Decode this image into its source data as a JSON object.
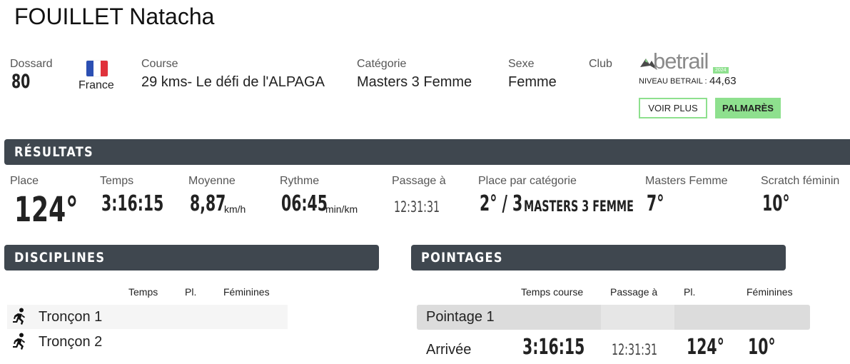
{
  "runner": {
    "name": "FOUILLET Natacha"
  },
  "info": {
    "dossard_label": "Dossard",
    "dossard_value": "80",
    "country": "France",
    "course_label": "Course",
    "course_value": "29 kms- Le défi de l'ALPAGA",
    "categorie_label": "Catégorie",
    "categorie_value": "Masters 3 Femme",
    "sexe_label": "Sexe",
    "sexe_value": "Femme",
    "club_label": "Club"
  },
  "betrail": {
    "logo_text": "betrail",
    "logo_badge": "2024",
    "niveau_label": "NIVEAU BETRAIL :",
    "niveau_value": "44,63",
    "voir_plus": "VOIR PLUS",
    "palmares": "PALMARÈS",
    "logo_color": "#8a8a8a",
    "accent_color": "#8ee08e"
  },
  "sections": {
    "resultats": "RÉSULTATS",
    "disciplines": "DISCIPLINES",
    "pointages": "POINTAGES"
  },
  "results": {
    "place_label": "Place",
    "place_value": "124°",
    "temps_label": "Temps",
    "temps_value": "3:16:15",
    "moyenne_label": "Moyenne",
    "moyenne_value": "8,87",
    "moyenne_unit": "km/h",
    "rythme_label": "Rythme",
    "rythme_value": "06:45",
    "rythme_unit": "min/km",
    "passage_label": "Passage à",
    "passage_value": "12:31:31",
    "placecat_label": "Place par catégorie",
    "placecat_value": "2° / 3",
    "placecat_cat": "MASTERS 3 FEMME",
    "masters_label": "Masters Femme",
    "masters_value": "7°",
    "scratch_label": "Scratch féminin",
    "scratch_value": "10°"
  },
  "disciplines": {
    "headers": [
      "Temps",
      "Pl.",
      "Féminines"
    ],
    "rows": [
      {
        "icon": "runner-icon",
        "name": "Tronçon 1"
      },
      {
        "icon": "runner-icon",
        "name": "Tronçon 2"
      }
    ]
  },
  "pointages": {
    "headers": [
      "Temps course",
      "Passage à",
      "Pl.",
      "Féminines"
    ],
    "rows": [
      {
        "name": "Pointage 1",
        "temps": "",
        "passage": "",
        "place": "",
        "feminines": ""
      },
      {
        "name": "Arrivée",
        "temps": "3:16:15",
        "passage": "12:31:31",
        "place": "124°",
        "feminines": "10°"
      }
    ]
  },
  "colors": {
    "bar_bg": "#3f474f",
    "row_bg": "#f5f5f5",
    "pointage_row_bg": "#dcdcdc",
    "pointage_row_bg_alt": "#e6e6e6"
  }
}
